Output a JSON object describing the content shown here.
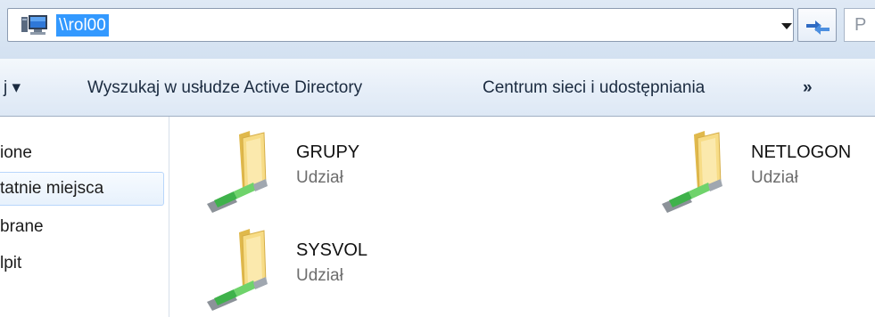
{
  "address_bar": {
    "value": "\\\\rol00",
    "icon": "computer-icon",
    "dropdown_icon": "chevron-down-icon",
    "refresh_icon": "refresh-arrows-icon",
    "search_placeholder": "P"
  },
  "command_bar": {
    "items": [
      {
        "label": "j ▾"
      },
      {
        "label": "Wyszukaj w usłudze Active Directory"
      },
      {
        "label": "Centrum sieci i udostępniania"
      },
      {
        "label": "»"
      }
    ]
  },
  "nav_pane": {
    "items": [
      {
        "label": "ione"
      },
      {
        "label": "tatnie miejsca",
        "selected": true
      },
      {
        "label": "brane"
      },
      {
        "label": "lpit"
      }
    ]
  },
  "shares": [
    {
      "name": "GRUPY",
      "type": "Udział",
      "icon": "shared-folder-icon"
    },
    {
      "name": "NETLOGON",
      "type": "Udział",
      "icon": "shared-folder-icon"
    },
    {
      "name": "SYSVOL",
      "type": "Udział",
      "icon": "shared-folder-icon"
    }
  ],
  "colors": {
    "selection": "#3399ff",
    "folder": "#f6d679",
    "network_pipe": "#3fb24b"
  }
}
